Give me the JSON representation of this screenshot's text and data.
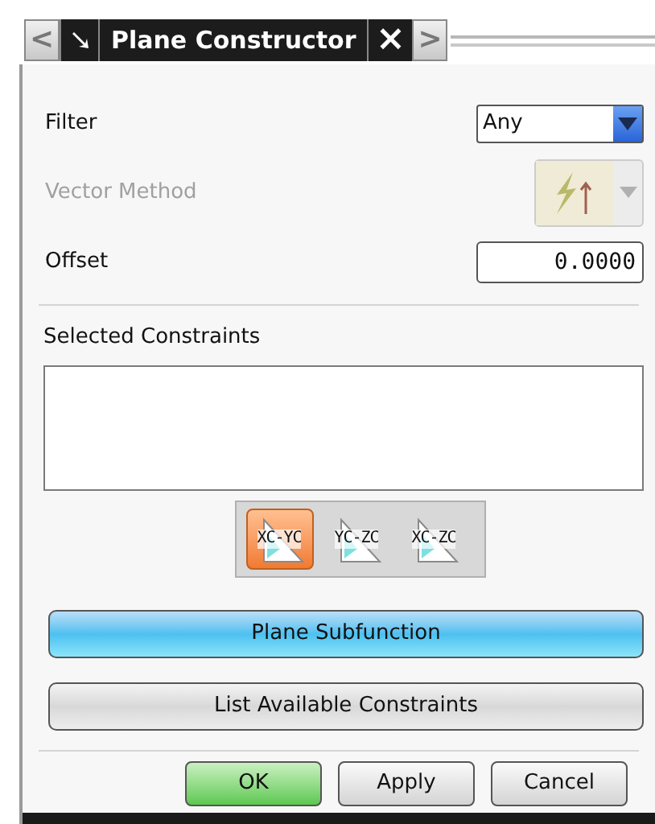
{
  "title_bar": {
    "prev": "<",
    "title": "Plane Constructor",
    "close": "×",
    "next": ">"
  },
  "fields": [
    {
      "kind": "dropdown",
      "label": "Filter",
      "value": "Any"
    },
    {
      "kind": "icon-dropdown",
      "label": "Vector Method",
      "disabled": true
    },
    {
      "kind": "number",
      "label": "Offset",
      "value": "0.0000"
    }
  ],
  "selected_constraints": {
    "label": "Selected Constraints"
  },
  "plane_buttons": [
    {
      "label": "XC-YC",
      "selected": true
    },
    {
      "label": "YC-ZC",
      "selected": false
    },
    {
      "label": "XC-ZC",
      "selected": false
    }
  ],
  "actions": [
    {
      "label": "Plane Subfunction",
      "selected": true
    },
    {
      "label": "List Available Constraints",
      "selected": false
    }
  ],
  "dialog_buttons": [
    {
      "label": "OK",
      "default": true
    },
    {
      "label": "Apply",
      "default": false
    },
    {
      "label": "Cancel",
      "default": false
    }
  ]
}
